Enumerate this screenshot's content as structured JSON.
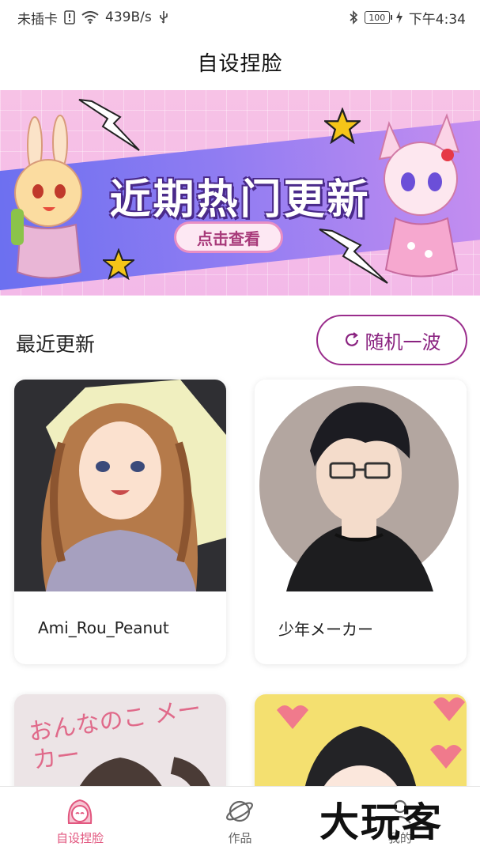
{
  "status_bar": {
    "carrier": "未插卡",
    "speed": "439B/s",
    "battery": "100",
    "time": "下午4:34"
  },
  "header": {
    "title": "自设捏脸"
  },
  "banner": {
    "title": "近期热门更新",
    "button_label": "点击查看"
  },
  "recent": {
    "title": "最近更新",
    "random_button": "随机一波"
  },
  "cards": [
    {
      "name": "Ami_Rou_Peanut"
    },
    {
      "name": "少年メーカー"
    },
    {
      "name": "",
      "art_text": "おんなのこ メーカー"
    },
    {
      "name": ""
    }
  ],
  "tabs": [
    {
      "label": "自设捏脸",
      "icon": "face-icon",
      "active": true
    },
    {
      "label": "作品",
      "icon": "planet-icon",
      "active": false
    },
    {
      "label": "我的",
      "icon": "user-icon",
      "active": false
    }
  ],
  "watermark": "大玩客",
  "colors": {
    "accent": "#8a2380",
    "tab_active": "#e2577f"
  }
}
